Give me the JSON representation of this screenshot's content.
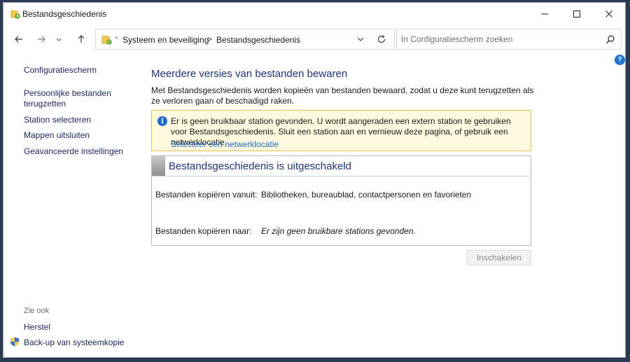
{
  "window": {
    "title": "Bestandsgeschiedenis"
  },
  "address_bar": {
    "breadcrumbs": [
      "Systeem en beveiliging",
      "Bestandsgeschiedenis"
    ],
    "separator": ">"
  },
  "search": {
    "placeholder": "In Configuratiescherm zoeken"
  },
  "sidebar": {
    "items": [
      {
        "label": "Configuratiescherm"
      },
      {
        "label": "Persoonlijke bestanden terugzetten"
      },
      {
        "label": "Station selecteren"
      },
      {
        "label": "Mappen uitsluiten"
      },
      {
        "label": "Geavanceerde instellingen"
      }
    ],
    "see_also_heading": "Zie ook",
    "see_also": [
      {
        "label": "Herstel"
      },
      {
        "label": "Back-up van systeemkopie"
      }
    ]
  },
  "main": {
    "title": "Meerdere versies van bestanden bewaren",
    "description": "Met Bestandsgeschiedenis worden kopieën van bestanden bewaard, zodat u deze kunt terugzetten als ze verloren gaan of beschadigd raken.",
    "info": {
      "message": "Er is geen bruikbaar station gevonden. U wordt aangeraden een extern station te gebruiken voor Bestandsgeschiedenis. Sluit een station aan en vernieuw deze pagina, of gebruik een netwerklocatie.",
      "link": "Selecteer een netwerklocatie"
    },
    "status": {
      "title": "Bestandsgeschiedenis is uitgeschakeld",
      "copy_from_label": "Bestanden kopiëren vanuit:",
      "copy_from_value": "Bibliotheken, bureaublad, contactpersonen en favorieten",
      "copy_to_label": "Bestanden kopiëren naar:",
      "copy_to_value": "Er zijn geen bruikbare stations gevonden."
    },
    "enable_button": "Inschakelen"
  },
  "colors": {
    "heading": "#1e3287",
    "link": "#1b6bd1",
    "info_background": "#fffae0",
    "info_border": "#e6c04a"
  }
}
